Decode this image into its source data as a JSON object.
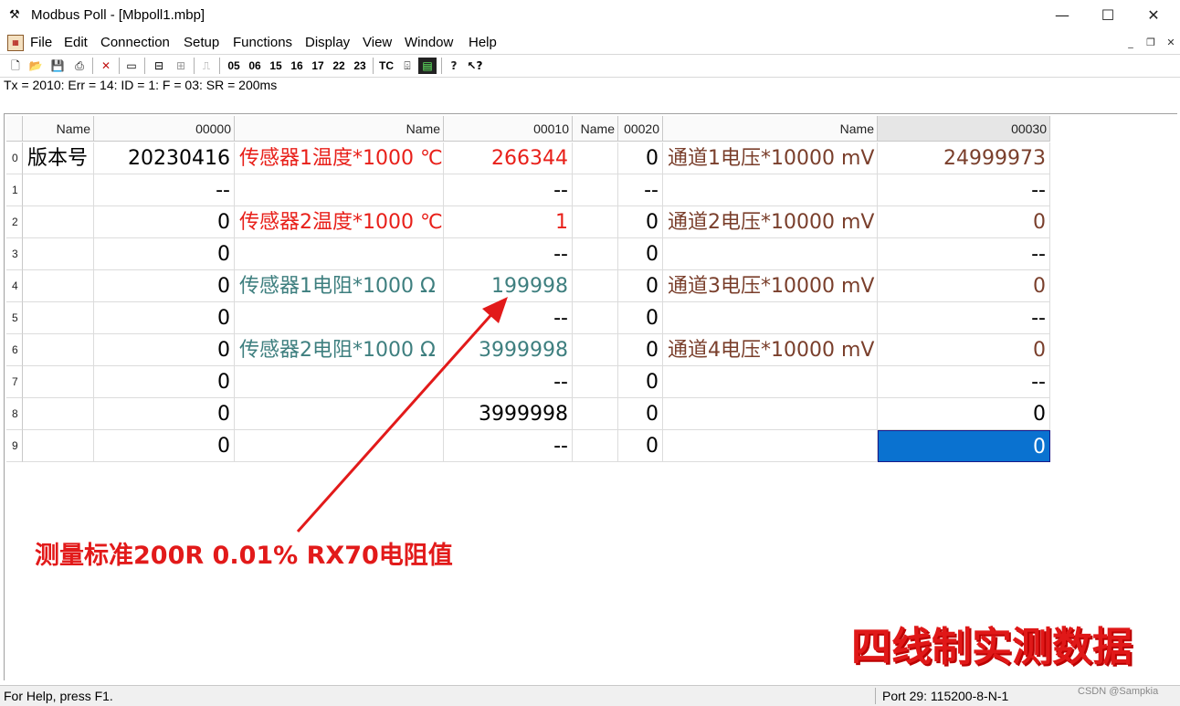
{
  "window": {
    "title": "Modbus Poll - [Mbpoll1.mbp]",
    "app_icon": "modbus-app-icon",
    "controls": {
      "minimize": "—",
      "maximize": "☐",
      "close": "✕"
    }
  },
  "menubar": {
    "items": [
      "File",
      "Edit",
      "Connection",
      "Setup",
      "Functions",
      "Display",
      "View",
      "Window",
      "Help"
    ],
    "mdi_controls": {
      "minimize": "_",
      "restore": "❐",
      "close": "✕"
    }
  },
  "toolbar": {
    "icons": [
      "new-icon",
      "open-icon",
      "save-icon",
      "print-icon",
      "close-connection-icon",
      "window-icon",
      "connect-icon",
      "disconnect-icon",
      "pulse-icon"
    ],
    "function_codes": [
      "05",
      "06",
      "15",
      "16",
      "17",
      "22",
      "23"
    ],
    "tc_label": "TC",
    "extra_icons": [
      "traffic-icon",
      "monitor-icon",
      "help-icon",
      "context-help-icon"
    ]
  },
  "status_line": "Tx = 2010: Err = 14: ID = 1: F = 03: SR = 200ms",
  "grid": {
    "headers": [
      "Name",
      "00000",
      "Name",
      "00010",
      "Name",
      "00020",
      "Name",
      "00030"
    ],
    "row_numbers": [
      "0",
      "1",
      "2",
      "3",
      "4",
      "5",
      "6",
      "7",
      "8",
      "9"
    ],
    "rows": [
      [
        "版本号",
        "20230416",
        "传感器1温度*1000 ℃",
        "266344",
        "",
        "0",
        "通道1电压*10000 mV",
        "24999973"
      ],
      [
        "",
        "--",
        "",
        "--",
        "",
        "--",
        "",
        "--"
      ],
      [
        "",
        "0",
        "传感器2温度*1000 ℃",
        "1",
        "",
        "0",
        "通道2电压*10000 mV",
        "0"
      ],
      [
        "",
        "0",
        "",
        "--",
        "",
        "0",
        "",
        "--"
      ],
      [
        "",
        "0",
        " 传感器1电阻*1000 Ω",
        "199998",
        "",
        "0",
        "通道3电压*10000 mV",
        "0"
      ],
      [
        "",
        "0",
        "",
        "--",
        "",
        "0",
        "",
        "--"
      ],
      [
        "",
        "0",
        " 传感器2电阻*1000 Ω",
        "3999998",
        "",
        "0",
        "通道4电压*10000 mV",
        "0"
      ],
      [
        "",
        "0",
        "",
        "--",
        "",
        "0",
        "",
        "--"
      ],
      [
        "",
        "0",
        "",
        "3999998",
        "",
        "0",
        "",
        "0"
      ],
      [
        "",
        "0",
        "",
        "--",
        "",
        "0",
        "",
        "0"
      ]
    ],
    "colors": {
      "default": "#000000",
      "red": "#e8201a",
      "teal": "#3e7f7f",
      "brown": "#7a3f2c"
    }
  },
  "annotation": "测量标准200R 0.01% RX70电阻值",
  "caption": "四线制实测数据",
  "statusbar": {
    "help_text": "For Help, press F1.",
    "port_text": "Port 29: 115200-8-N-1",
    "watermark": "CSDN @Sampkia"
  }
}
